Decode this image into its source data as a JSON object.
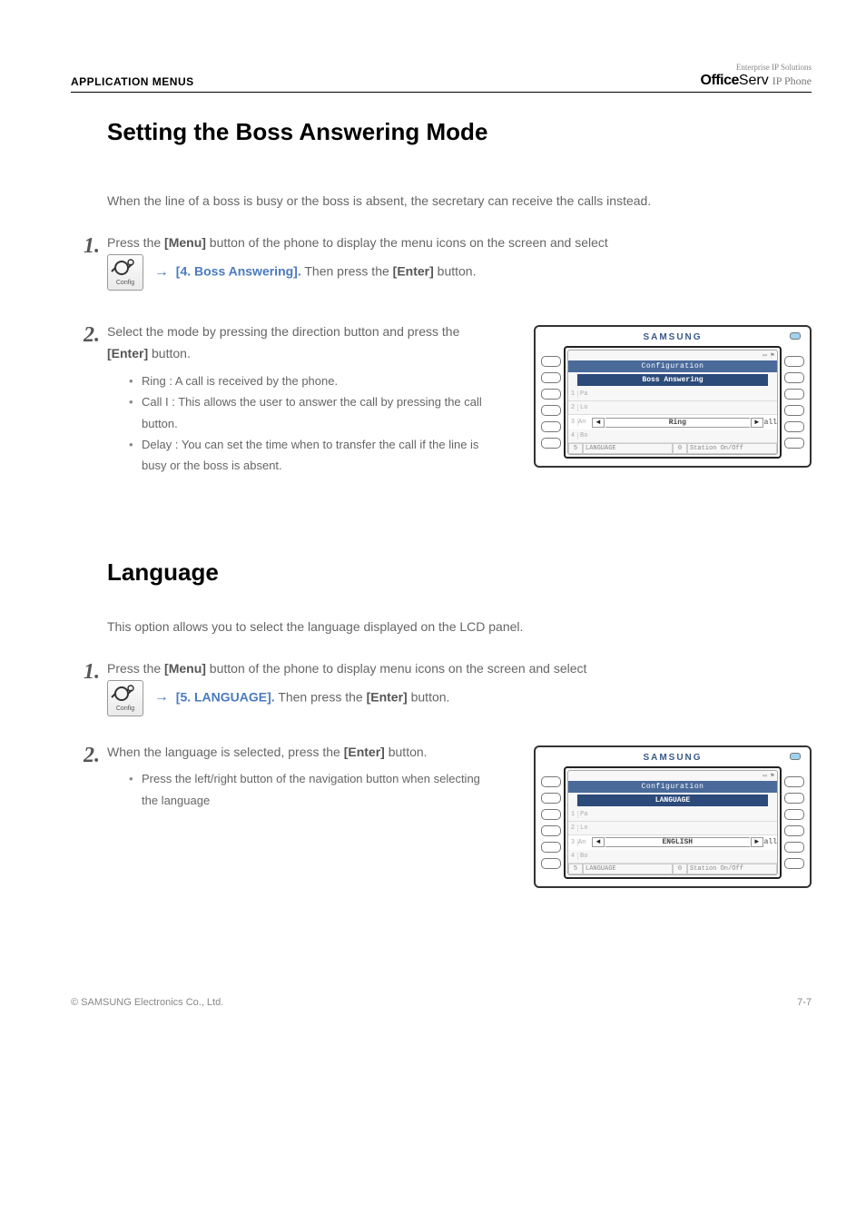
{
  "header": {
    "left": "APPLICATION MENUS",
    "brand_small": "Enterprise IP Solutions",
    "brand_off": "Office",
    "brand_serv": "Serv",
    "brand_ip": "IP Phone"
  },
  "section1": {
    "title": "Setting the Boss Answering Mode",
    "intro": "When the line of a boss is busy or the boss is absent, the secretary can receive the calls instead.",
    "step1_prefix": "Press the ",
    "step1_menu": "[Menu]",
    "step1_mid": " button of the phone to display the menu icons on the screen and select ",
    "step1_arrow": "→",
    "step1_target": "[4. Boss Answering].",
    "step1_after": " Then press the ",
    "step1_enter": "[Enter]",
    "step1_end": " button.",
    "config_label": "Config",
    "step2_line1_a": "Select the mode by pressing the direction button and press the ",
    "step2_enter": "[Enter]",
    "step2_line1_b": " button.",
    "bullets": [
      "Ring : A call is received by the phone.",
      "Call I : This allows the user to answer the call by pressing the call button.",
      "Delay : You can set the time when to transfer the call if the line is busy or the boss is absent."
    ],
    "phone": {
      "brand": "SAMSUNG",
      "title": "Configuration",
      "band": "Boss Answering",
      "rows_left": [
        "1",
        "2",
        "3",
        "4",
        "5"
      ],
      "rows_text": [
        "Pa",
        "Lo",
        "An",
        "Bo",
        "LANGUAGE"
      ],
      "select_value": "Ring",
      "right_label": "all",
      "foot_right_num": "0",
      "foot_right": "Station On/Off"
    }
  },
  "section2": {
    "title": "Language",
    "intro": "This option allows you to select the language displayed on the LCD panel.",
    "step1_prefix": "Press the ",
    "step1_menu": "[Menu]",
    "step1_mid": " button of the phone to display menu icons on the screen and select ",
    "step1_arrow": "→",
    "step1_target": "[5. LANGUAGE].",
    "step1_after": " Then press the ",
    "step1_enter": "[Enter]",
    "step1_end": " button.",
    "config_label": "Config",
    "step2_a": "When the language is selected, press the ",
    "step2_enter": "[Enter]",
    "step2_b": " button.",
    "bullets": [
      "Press the left/right button of the navigation button when selecting the language"
    ],
    "phone": {
      "brand": "SAMSUNG",
      "title": "Configuration",
      "band": "LANGUAGE",
      "rows_left": [
        "1",
        "2",
        "3",
        "4",
        "5"
      ],
      "rows_text": [
        "Pa",
        "Lo",
        "An",
        "Bo",
        "LANGUAGE"
      ],
      "select_value": "ENGLISH",
      "right_label": "all",
      "foot_right_num": "0",
      "foot_right": "Station On/Off"
    }
  },
  "page_footer": "© SAMSUNG Electronics Co., Ltd.",
  "page_number": "7-7"
}
